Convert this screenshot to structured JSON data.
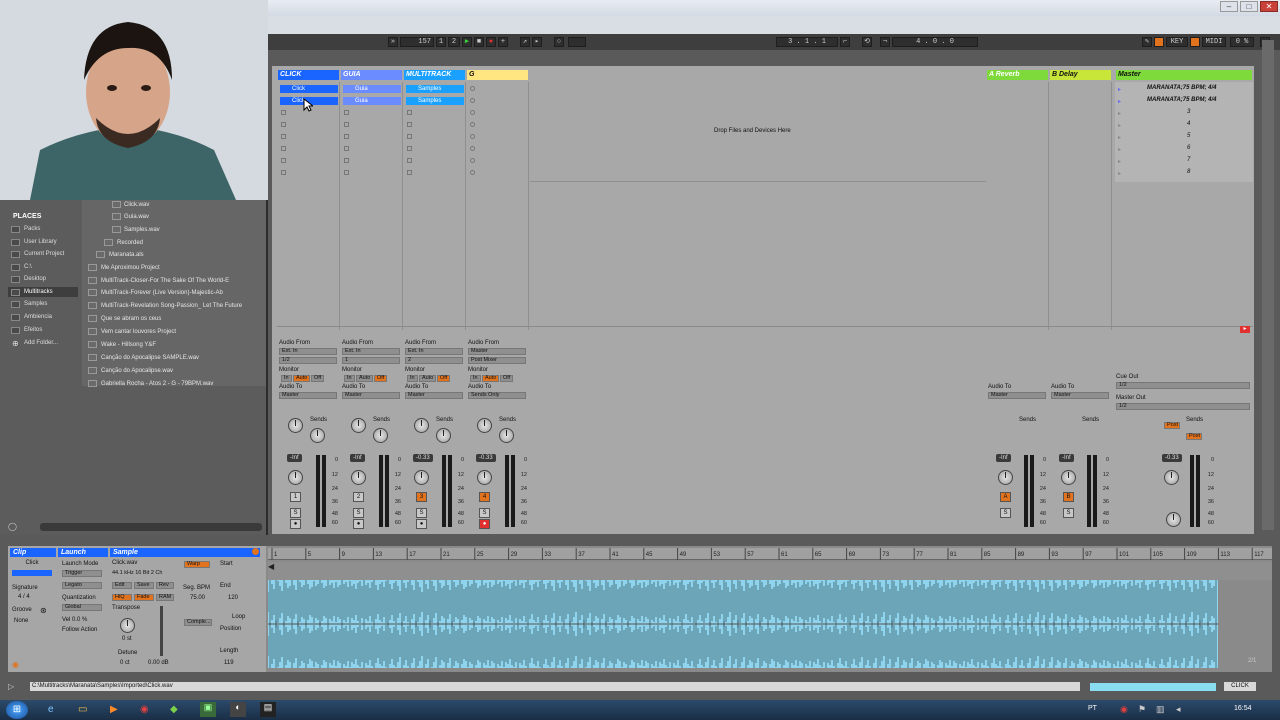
{
  "transport": {
    "tempo": "157",
    "sig_num": "1",
    "sig_den": "2",
    "position": "3 . 1 . 1",
    "loop_length": "4 . 0 . 0",
    "key_label": "KEY",
    "midi_label": "MIDI",
    "cpu": "0 %"
  },
  "browser": {
    "places_header": "PLACES",
    "places": [
      "Packs",
      "User Library",
      "Current Project",
      "C:\\",
      "Desktop",
      "Multitracks",
      "Samples",
      "Ambiencia",
      "Efeitos",
      "Add Folder..."
    ],
    "files": [
      "Click.wav",
      "Guia.wav",
      "Samples.wav",
      "Recorded",
      "Maranata.als",
      "Me Aproximou Project",
      "MultiTrack-Closer-For The Sake Of The World-E",
      "MultiTrack-Forever (Live Version)-Majestic-Ab",
      "MultiTrack-Revelation Song-Passion_ Let The Future",
      "Que se abram os ceus",
      "Vem cantar louvores Project",
      "Wake - Hillsong Y&F",
      "Canção do Apocalipse SAMPLE.wav",
      "Canção do Apocalipse.wav",
      "Gabriella Rocha - Atos 2 - G - 79BPM.wav"
    ]
  },
  "tracks": [
    {
      "name": "CLICK",
      "color": "#1a64ff",
      "text": "#ffffff",
      "clips": [
        "Click",
        "Click"
      ],
      "audio_from": "Ext. In",
      "input": "1/2",
      "monitor": [
        "In",
        "Auto",
        "Off"
      ],
      "audio_to": "Master",
      "vol": "-Inf",
      "num": "1",
      "num_on": false
    },
    {
      "name": "GUIA",
      "color": "#6a8cff",
      "text": "#ffffff",
      "clips": [
        "Guia",
        "Guia"
      ],
      "audio_from": "Ext. In",
      "input": "1",
      "monitor": [
        "In",
        "Auto",
        "Off"
      ],
      "audio_to": "Master",
      "vol": "-Inf",
      "num": "2",
      "num_on": false
    },
    {
      "name": "MULTITRACK",
      "color": "#1aa0ff",
      "text": "#ffffff",
      "clips": [
        "Samples",
        "Samples"
      ],
      "audio_from": "Ext. In",
      "input": "2",
      "monitor": [
        "In",
        "Auto",
        "Off"
      ],
      "audio_to": "Master",
      "vol": "-0.33",
      "num": "3",
      "num_on": true
    },
    {
      "name": "G",
      "color": "#ffe680",
      "text": "#111111",
      "clips": [],
      "audio_from": "Master",
      "input": "Post Mixer",
      "monitor": [
        "In",
        "Auto",
        "Off"
      ],
      "audio_to": "Sends Only",
      "vol": "-0.33",
      "num": "4",
      "num_on": true
    }
  ],
  "returns": [
    {
      "name": "A Reverb",
      "color": "#7ed93a",
      "audio_to": "Master",
      "vol": "-Inf",
      "letter": "A"
    },
    {
      "name": "B Delay",
      "color": "#c8e63a",
      "audio_to": "Master",
      "vol": "-Inf",
      "letter": "B"
    }
  ],
  "master": {
    "name": "Master",
    "color": "#7ed93a",
    "scenes": [
      "MARANATA;75 BPM; 4/4",
      "MARANATA;75 BPM; 4/4",
      "3",
      "4",
      "5",
      "6",
      "7",
      "8"
    ],
    "cue_out_label": "Cue Out",
    "cue_out": "1/2",
    "master_out_label": "Master Out",
    "master_out": "1/2",
    "vol": "-0.33",
    "post": "Post"
  },
  "labels": {
    "drop": "Drop Files and Devices Here",
    "audio_from": "Audio From",
    "monitor": "Monitor",
    "audio_to": "Audio To",
    "sends": "Sends",
    "solo": "S"
  },
  "meter_scale": [
    "0",
    "12",
    "24",
    "36",
    "48",
    "60"
  ],
  "clip": {
    "header": "Clip",
    "launch": "Launch",
    "sample": "Sample",
    "name": "Click",
    "file": "Click.wav",
    "info": "44.1 kHz 16 Bit 2 Ch",
    "signature_label": "Signature",
    "sig": "4 / 4",
    "groove_label": "Groove",
    "groove": "None",
    "launch_mode_label": "Launch Mode",
    "launch_mode": "Trigger",
    "legato": "Legato",
    "quantization_label": "Quantization",
    "quantization": "Global",
    "vel": "Vel  0.0 %",
    "follow_label": "Follow Action",
    "edit": "Edit",
    "save": "Save",
    "rev": "Rev",
    "hiq": "HiQ",
    "fade": "Fade",
    "ram": "RAM",
    "transpose_label": "Transpose",
    "transpose": "0 st",
    "detune_label": "Detune",
    "detune": "0 ct",
    "gain": "0.00 dB",
    "warp": "Warp",
    "seg_bpm_label": "Seg. BPM",
    "seg_bpm": "75.00",
    "complex": "Comple...",
    "start_label": "Start",
    "end_label": "End",
    "end": "120",
    "loop_label": "Loop",
    "position_label": "Position",
    "length_label": "Length",
    "length": "119"
  },
  "ruler": [
    "1",
    "5",
    "9",
    "13",
    "17",
    "21",
    "25",
    "29",
    "33",
    "37",
    "41",
    "45",
    "49",
    "53",
    "57",
    "61",
    "65",
    "69",
    "73",
    "77",
    "81",
    "85",
    "89",
    "93",
    "97",
    "101",
    "105",
    "109",
    "113",
    "117"
  ],
  "status": {
    "path": "C:\\Multitracks\\Maranata\\Samples\\Imported\\Click.wav",
    "track": "CLICK",
    "page": "2/1"
  },
  "taskbar": {
    "lang": "PT",
    "clock": "16:54"
  }
}
